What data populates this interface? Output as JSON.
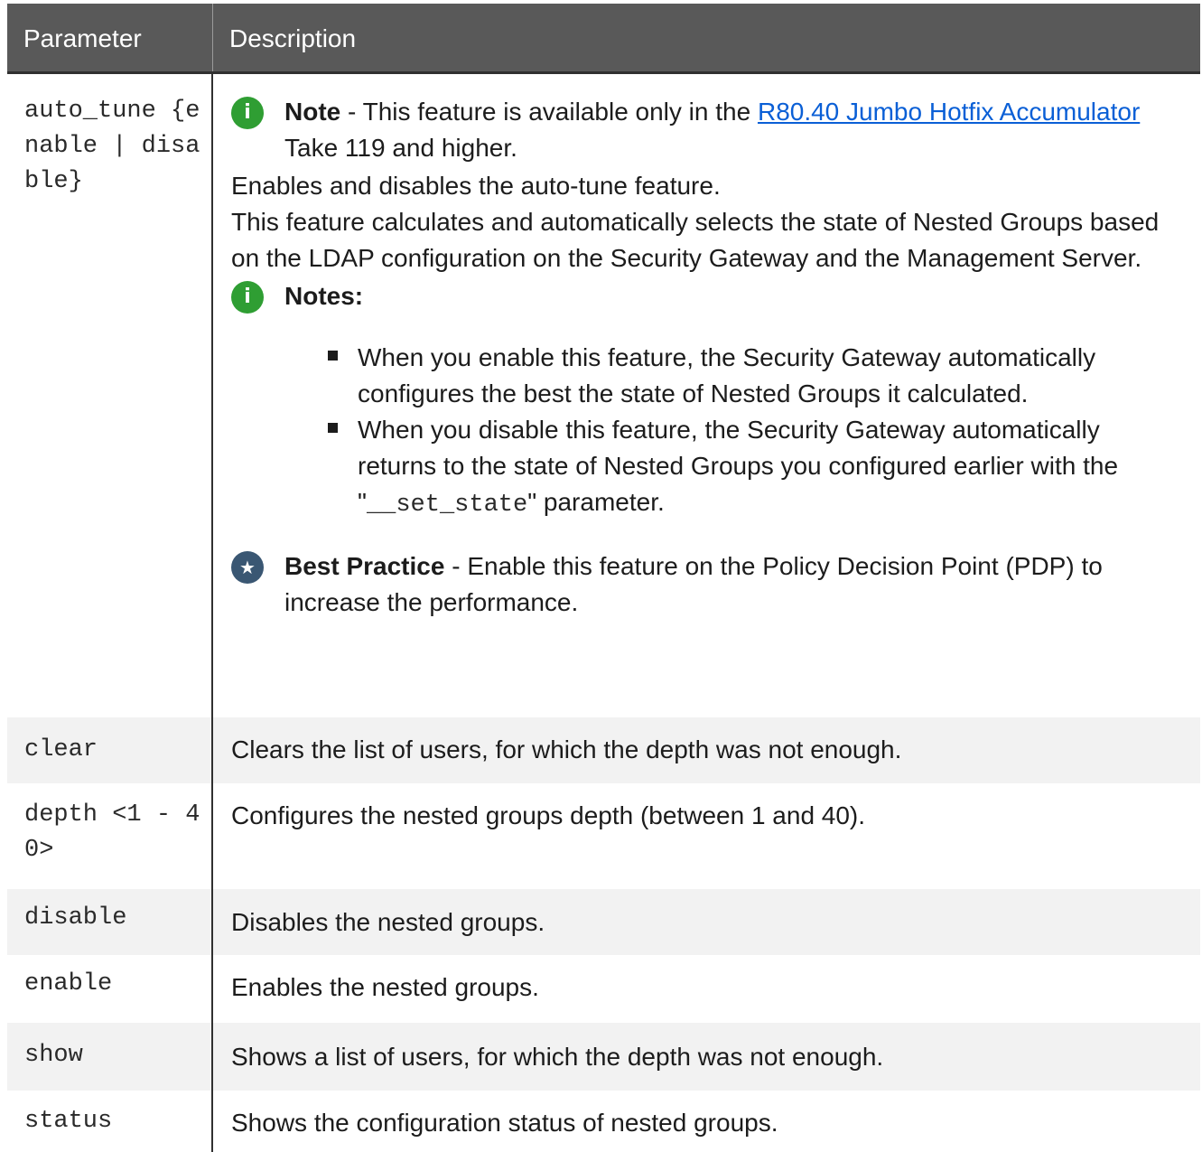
{
  "header": {
    "col1": "Parameter",
    "col2": "Description"
  },
  "auto_tune": {
    "param": "auto_tune {enable | disable}",
    "note_label": "Note",
    "note_text_1": " - This feature is available only in the ",
    "note_link": "R80.40 Jumbo Hotfix Accumulator",
    "note_text_2": " Take 119 and higher.",
    "line1": "Enables and disables the auto-tune feature.",
    "line2": "This feature calculates and automatically selects the state of Nested Groups based on the LDAP configuration on the Security Gateway and the Management Server.",
    "notes_label": "Notes:",
    "bullet1": "When you enable this feature, the Security Gateway automatically configures the best the state of Nested Groups it calculated.",
    "bullet2_prefix": "When you disable this feature, the Security Gateway automatically returns to the state of Nested Groups you configured earlier with the \"",
    "bullet2_code": "__set_state",
    "bullet2_suffix": "\" parameter.",
    "bp_label": "Best Practice",
    "bp_text": " - Enable this feature on the Policy Decision Point (PDP) to increase the performance."
  },
  "rows": [
    {
      "param": "clear",
      "desc": "Clears the list of users, for which the depth was not enough."
    },
    {
      "param": "depth <1 - 40>",
      "desc": "Configures the nested groups depth (between 1 and 40)."
    },
    {
      "param": "disable",
      "desc": "Disables the nested groups."
    },
    {
      "param": "enable",
      "desc": "Enables the nested groups."
    },
    {
      "param": "show",
      "desc": "Shows a list of users, for which the depth was not enough."
    },
    {
      "param": "status",
      "desc": "Shows the configuration status of nested groups."
    }
  ],
  "icons": {
    "info": "info-icon",
    "star": "star-icon"
  },
  "colors": {
    "header_bg": "#595959",
    "link": "#0a5fd6",
    "info_icon": "#2f9e33",
    "star_icon": "#3a5773"
  }
}
